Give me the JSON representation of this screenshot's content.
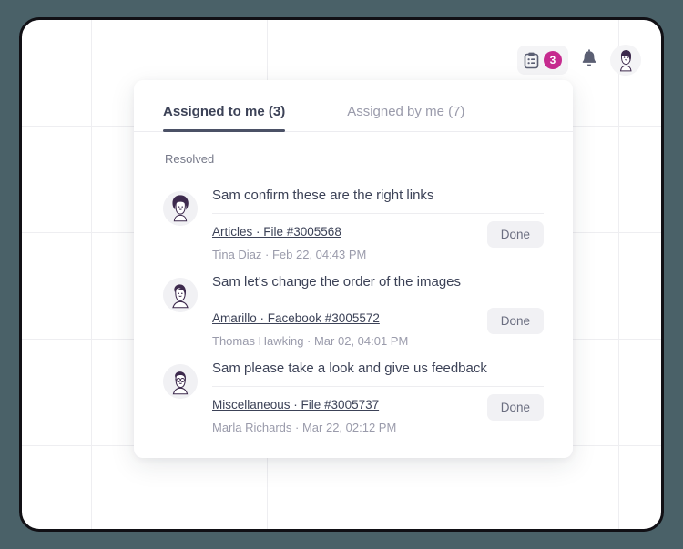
{
  "header": {
    "tasks_button": {
      "icon": "clipboard-icon",
      "badge_count": "3"
    },
    "notifications_icon": "bell-icon",
    "avatar": "user-avatar"
  },
  "panel": {
    "tabs": [
      {
        "label": "Assigned to me (3)",
        "active": true
      },
      {
        "label": "Assigned by me (7)",
        "active": false
      }
    ],
    "section_label": "Resolved",
    "tasks": [
      {
        "title": "Sam confirm these are the right links",
        "source": "Articles · File #3005568",
        "author": "Tina Diaz · Feb 22, 04:43 PM",
        "action_label": "Done",
        "avatar": "avatar-afro"
      },
      {
        "title": "Sam let's change the order of the images",
        "source": "Amarillo · Facebook #3005572",
        "author": "Thomas Hawking · Mar 02, 04:01 PM",
        "action_label": "Done",
        "avatar": "avatar-swept"
      },
      {
        "title": "Sam please take a look and give us feedback",
        "source": "Miscellaneous · File #3005737",
        "author": "Marla Richards · Mar 22, 02:12 PM",
        "action_label": "Done",
        "avatar": "avatar-glasses"
      }
    ]
  },
  "colors": {
    "page_background": "#4a6168",
    "badge": "#c62b8f",
    "text_primary": "#3c4257",
    "text_muted": "#9a9bab",
    "hair": "#3d2a4d"
  }
}
